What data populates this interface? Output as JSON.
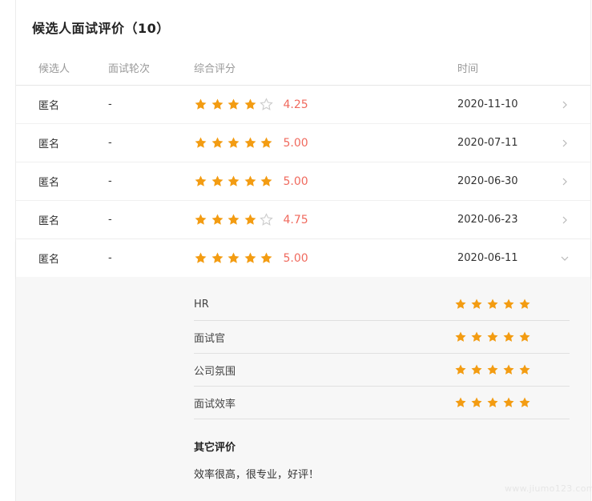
{
  "panel": {
    "title": "候选人面试评价",
    "count": "10"
  },
  "table": {
    "headers": {
      "candidate": "候选人",
      "round": "面试轮次",
      "score": "综合评分",
      "time": "时间"
    },
    "rows": [
      {
        "candidate": "匿名",
        "round": "-",
        "rating": 4.25,
        "score": "4.25",
        "date": "2020-11-10",
        "stars": [
          "full",
          "full",
          "full",
          "full",
          "empty"
        ],
        "arrow": "chevron-right-icon"
      },
      {
        "candidate": "匿名",
        "round": "-",
        "rating": 5.0,
        "score": "5.00",
        "date": "2020-07-11",
        "stars": [
          "full",
          "full",
          "full",
          "full",
          "full"
        ],
        "arrow": "chevron-right-icon"
      },
      {
        "candidate": "匿名",
        "round": "-",
        "rating": 5.0,
        "score": "5.00",
        "date": "2020-06-30",
        "stars": [
          "full",
          "full",
          "full",
          "full",
          "full"
        ],
        "arrow": "chevron-right-icon"
      },
      {
        "candidate": "匿名",
        "round": "-",
        "rating": 4.75,
        "score": "4.75",
        "date": "2020-06-23",
        "stars": [
          "full",
          "full",
          "full",
          "full",
          "empty"
        ],
        "arrow": "chevron-right-icon"
      },
      {
        "candidate": "匿名",
        "round": "-",
        "rating": 5.0,
        "score": "5.00",
        "date": "2020-06-11",
        "stars": [
          "full",
          "full",
          "full",
          "full",
          "full"
        ],
        "arrow": "chevron-down-icon",
        "expanded": true
      }
    ]
  },
  "detail": {
    "items": [
      {
        "label": "HR",
        "rating": 5
      },
      {
        "label": "面试官",
        "rating": 5
      },
      {
        "label": "公司氛围",
        "rating": 5
      },
      {
        "label": "面试效率",
        "rating": 5
      }
    ],
    "other_title": "其它评价",
    "other_text": "效率很高，很专业，好评！"
  },
  "colors": {
    "star_filled": "#f39c12",
    "star_empty": "#cccccc",
    "score_text": "#f06a5e",
    "detail_bg": "#f7f7f7"
  },
  "watermark": "www.jiumo123.com"
}
